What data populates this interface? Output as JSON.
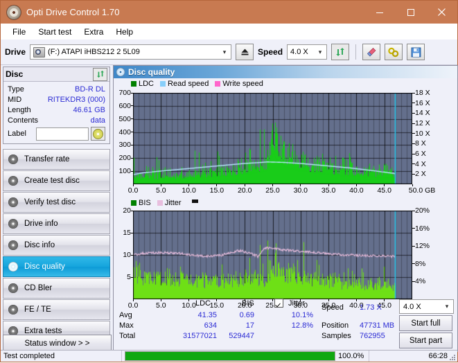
{
  "window": {
    "title": "Opti Drive Control 1.70",
    "accent": "#c87a51",
    "buttons": {
      "minimize": "minimize-icon",
      "maximize": "maximize-icon",
      "close": "close-icon"
    }
  },
  "menu": {
    "items": [
      "File",
      "Start test",
      "Extra",
      "Help"
    ]
  },
  "toolbar": {
    "drive_label": "Drive",
    "drive_value": "(F:)  ATAPI iHBS212  2 5L09",
    "eject_icon": "eject-icon",
    "speed_label": "Speed",
    "speed_value": "4.0 X",
    "refresh_icon": "refresh-icon",
    "erase_icon": "eraser-icon",
    "tools_icon": "tools-icon",
    "save_icon": "save-icon"
  },
  "disc_panel": {
    "title": "Disc",
    "refresh_icon": "refresh-icon",
    "rows": [
      {
        "key": "Type",
        "value": "BD-R DL"
      },
      {
        "key": "MID",
        "value": "RITEKDR3 (000)"
      },
      {
        "key": "Length",
        "value": "46.61 GB"
      },
      {
        "key": "Contents",
        "value": "data"
      }
    ],
    "label_key": "Label",
    "label_value": "",
    "label_button_icon": "disc-icon"
  },
  "sidebar": {
    "items": [
      {
        "label": "Transfer rate",
        "icon": "disc-icon",
        "selected": false
      },
      {
        "label": "Create test disc",
        "icon": "disc-icon",
        "selected": false
      },
      {
        "label": "Verify test disc",
        "icon": "disc-icon",
        "selected": false
      },
      {
        "label": "Drive info",
        "icon": "disc-icon",
        "selected": false
      },
      {
        "label": "Disc info",
        "icon": "disc-icon",
        "selected": false
      },
      {
        "label": "Disc quality",
        "icon": "disc-icon",
        "selected": true
      },
      {
        "label": "CD Bler",
        "icon": "disc-icon",
        "selected": false
      },
      {
        "label": "FE / TE",
        "icon": "disc-icon",
        "selected": false
      },
      {
        "label": "Extra tests",
        "icon": "disc-icon",
        "selected": false
      }
    ],
    "status_window_label": "Status window > >"
  },
  "content": {
    "header_title": "Disc quality",
    "header_icon": "disc-icon"
  },
  "stats": {
    "col_headers": [
      "LDC",
      "BIS"
    ],
    "jitter_label": "Jitter",
    "jitter_checked": true,
    "rows": [
      {
        "name": "Avg",
        "ldc": "41.35",
        "bis": "0.69",
        "jitter": "10.1%"
      },
      {
        "name": "Max",
        "ldc": "634",
        "bis": "17",
        "jitter": "12.8%"
      },
      {
        "name": "Total",
        "ldc": "31577021",
        "bis": "529447",
        "jitter": ""
      }
    ],
    "speed_label": "Speed",
    "speed_value": "1.73 X",
    "position_label": "Position",
    "position_value": "47731 MB",
    "samples_label": "Samples",
    "samples_value": "762955",
    "speed_select_value": "4.0 X",
    "start_full_label": "Start full",
    "start_part_label": "Start part"
  },
  "statusbar": {
    "message": "Test completed",
    "progress_pct": "100.0%",
    "progress_value": 100,
    "elapsed": "66:28"
  },
  "chart_data": [
    {
      "type": "bar",
      "name": "ldc-chart",
      "title": "",
      "xlabel": "GB",
      "ylabel": "",
      "legend": [
        {
          "label": "LDC",
          "color": "#008000"
        },
        {
          "label": "Read speed",
          "color": "#87cefa"
        },
        {
          "label": "Write speed",
          "color": "#ff66cc"
        }
      ],
      "legend_position": "top-left",
      "grid": true,
      "plot_bg": "#646f8c",
      "xlim": [
        0,
        50
      ],
      "xticks": [
        "0.0",
        "5.0",
        "10.0",
        "15.0",
        "20.0",
        "25.0",
        "30.0",
        "35.0",
        "40.0",
        "45.0",
        "50.0 GB"
      ],
      "ylim": [
        0,
        700
      ],
      "yticks": [
        "100",
        "200",
        "300",
        "400",
        "500",
        "600",
        "700"
      ],
      "y2label": "X",
      "y2lim": [
        0,
        18
      ],
      "y2ticks": [
        "2 X",
        "4 X",
        "6 X",
        "8 X",
        "10 X",
        "12 X",
        "14 X",
        "16 X",
        "18 X"
      ],
      "data_end_gb": 46.9,
      "series": [
        {
          "name": "LDC",
          "color": "#19cc19",
          "type": "bar",
          "note": "baseline ~60-120 rising to ~200 near 23GB, dense spike cluster 23-25GB peaking ~630, declining tail to 46.9GB",
          "baseline": [
            70,
            75,
            72,
            70,
            68,
            70,
            72,
            74,
            78,
            80,
            84,
            90,
            95,
            98,
            104,
            110,
            118,
            126,
            140,
            150,
            160,
            170,
            185,
            430,
            300,
            250,
            215,
            195,
            180,
            170,
            160,
            150,
            140,
            132,
            126,
            120,
            114,
            108,
            104,
            100,
            96,
            92,
            88,
            84,
            80,
            76,
            74
          ],
          "peaks": [
            210,
            250,
            155,
            120,
            230,
            150,
            190,
            215,
            160,
            190,
            300,
            255,
            270,
            215,
            310,
            185,
            340,
            230,
            430,
            300,
            250,
            630,
            600,
            520,
            560,
            390,
            345,
            420,
            330,
            310,
            250,
            290,
            230,
            210,
            240,
            230,
            260,
            200,
            190,
            170,
            200,
            180,
            160,
            150,
            140,
            130,
            120
          ]
        },
        {
          "name": "Read speed",
          "color": "#b8e8ff",
          "type": "line",
          "note": "white/cyan line, rises from ~2X at 0GB to ~4.3X around 23GB, then decreases to ~2X at 46.9GB",
          "values_x": [
            0,
            2,
            5,
            8,
            11,
            14,
            17,
            20,
            23,
            24,
            27,
            30,
            33,
            36,
            39,
            42,
            45,
            46.9
          ],
          "values_y": [
            1.9,
            2.3,
            2.6,
            2.9,
            3.2,
            3.5,
            3.8,
            4.1,
            4.3,
            4.4,
            4.3,
            4.1,
            3.8,
            3.5,
            3.2,
            2.8,
            2.4,
            2.1
          ]
        }
      ],
      "cursor_x_gb": 46.9,
      "cursor_color": "#30c8f0"
    },
    {
      "type": "bar",
      "name": "bis-jitter-chart",
      "title": "",
      "xlabel": "GB",
      "ylabel": "",
      "legend": [
        {
          "label": "BIS",
          "color": "#008000"
        },
        {
          "label": "Jitter",
          "color": "#e8bede"
        }
      ],
      "legend_position": "top-left",
      "grid": true,
      "plot_bg": "#646f8c",
      "xlim": [
        0,
        50
      ],
      "xticks": [
        "0.0",
        "5.0",
        "10.0",
        "15.0",
        "20.0",
        "25.0",
        "30.0",
        "35.0",
        "40.0",
        "45.0",
        "50.0 GB"
      ],
      "ylim": [
        0,
        20
      ],
      "yticks": [
        "5",
        "10",
        "15",
        "20"
      ],
      "y2lim": [
        0,
        20
      ],
      "y2ticks": [
        "4%",
        "8%",
        "12%",
        "16%",
        "20%"
      ],
      "data_end_gb": 46.9,
      "series": [
        {
          "name": "BIS",
          "color": "#6ee016",
          "type": "bar",
          "note": "dense green bars mostly 3-7, spike cluster near 23-25GB reaching ~17, decreasing to ~2-4 by 46GB",
          "baseline": [
            6.0,
            5.8,
            5.6,
            5.5,
            5.4,
            5.3,
            5.4,
            5.2,
            5.0,
            4.9,
            4.8,
            4.6,
            4.4,
            4.2,
            4.2,
            4.3,
            4.4,
            4.5,
            4.6,
            4.7,
            4.6,
            4.8,
            5.0,
            9.0,
            7.5,
            6.6,
            6.0,
            5.6,
            5.2,
            5.0,
            4.8,
            4.6,
            4.4,
            4.2,
            4.0,
            3.9,
            3.8,
            3.7,
            3.6,
            3.5,
            3.4,
            3.3,
            3.2,
            3.1,
            3.0,
            2.9,
            2.8
          ],
          "peaks": [
            9.5,
            8.5,
            9.0,
            7.5,
            8.0,
            7.0,
            8.5,
            7.2,
            8.8,
            7.4,
            8.0,
            7.6,
            8.4,
            7.0,
            8.2,
            7.8,
            9.2,
            8.4,
            7.6,
            12.0,
            8.4,
            17.0,
            15.5,
            14.0,
            13.0,
            12.5,
            11.0,
            10.0,
            13.5,
            9.5,
            10.5,
            9.0,
            8.5,
            9.5,
            8.0,
            9.0,
            13.5,
            8.2,
            7.6,
            8.0,
            7.0,
            8.4,
            6.8,
            7.4,
            6.6,
            6.0,
            5.4
          ]
        },
        {
          "name": "Jitter",
          "color": "#e6bcdc",
          "type": "line",
          "note": "pink line hovering ~10-11%, peak ~11.5% near 19GB, dipping to ~9% around 23GB then ~11.5% and gently declining to ~9.5%",
          "values_x": [
            0,
            2,
            4,
            6,
            8,
            10,
            12,
            14,
            16,
            18,
            19,
            21,
            22.5,
            23.5,
            25,
            28,
            31,
            34,
            37,
            40,
            43,
            46,
            46.9
          ],
          "values_y": [
            10.0,
            10.4,
            10.5,
            10.5,
            10.4,
            10.1,
            9.8,
            9.7,
            10.0,
            10.6,
            11.0,
            10.4,
            9.6,
            11.6,
            11.4,
            11.0,
            10.7,
            10.4,
            10.1,
            9.9,
            9.8,
            9.7,
            9.6
          ]
        }
      ],
      "cursor_x_gb": 46.9,
      "cursor_color": "#30c8f0"
    }
  ]
}
